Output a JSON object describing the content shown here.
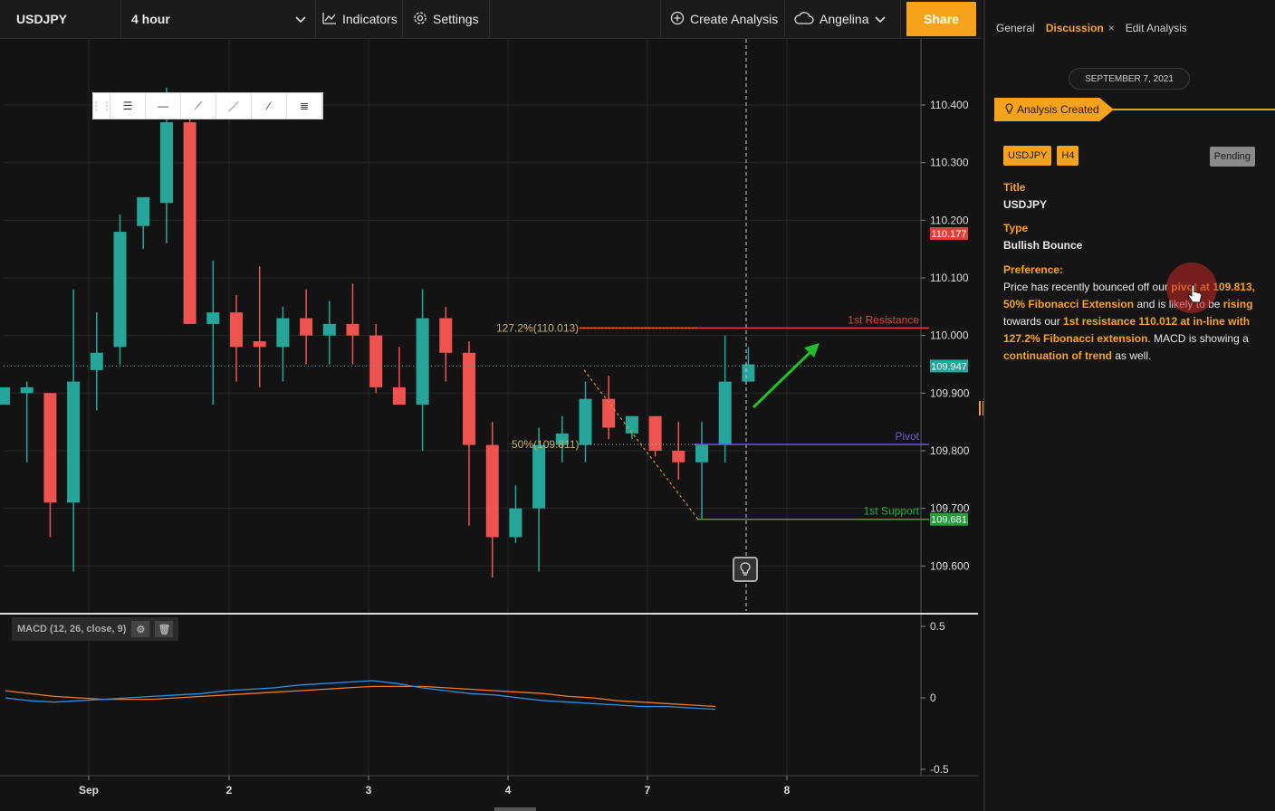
{
  "toolbar": {
    "symbol": "USDJPY",
    "interval": "4 hour",
    "indicators_label": "Indicators",
    "settings_label": "Settings",
    "create_analysis_label": "Create Analysis",
    "user_name": "Angelina",
    "share_label": "Share"
  },
  "panel": {
    "tabs": [
      {
        "label": "General"
      },
      {
        "label": "Discussion",
        "closable": true
      },
      {
        "label": "Edit Analysis"
      }
    ],
    "close_glyph": "×",
    "date": "SEPTEMBER 7, 2021",
    "event_label": "Analysis Created",
    "badges": [
      "USDJPY",
      "H4"
    ],
    "status": "Pending",
    "title_label": "Title",
    "title_value": "USDJPY",
    "type_label": "Type",
    "type_value": "Bullish Bounce",
    "preference_label": "Preference:",
    "preference_parts": [
      {
        "text": "Price has recently bounced off our ",
        "hl": false
      },
      {
        "text": "pivot at 109.813, 50% Fibonacci Extension",
        "hl": true
      },
      {
        "text": " and is likely to be ",
        "hl": false
      },
      {
        "text": "rising",
        "hl": true
      },
      {
        "text": " towards our ",
        "hl": false
      },
      {
        "text": "1st resistance 110.012 at in-line with 127.2% Fibonacci extension",
        "hl": true
      },
      {
        "text": ". MACD is showing a ",
        "hl": false
      },
      {
        "text": "continuation of trend",
        "hl": true
      },
      {
        "text": " as well.",
        "hl": false
      }
    ]
  },
  "chart": {
    "price_ticks": [
      "110.400",
      "110.300",
      "110.200",
      "110.100",
      "110.000",
      "109.900",
      "109.800",
      "109.700",
      "109.600"
    ],
    "x_ticks": [
      "Sep",
      "2",
      "3",
      "4",
      "7",
      "8"
    ],
    "macd_label": "MACD (12, 26, close, 9)",
    "macd_ticks": [
      "0.5",
      "0",
      "-0.5"
    ],
    "price_tags": [
      {
        "text": "110.177",
        "price": 110.177,
        "color": "#e0403a"
      },
      {
        "text": "109.947",
        "price": 109.947,
        "color": "#26a69a"
      },
      {
        "text": "109.681",
        "price": 109.681,
        "color": "#22a03a"
      }
    ],
    "levels": [
      {
        "label": "1st Resistance",
        "price": 110.013,
        "color": "#e0403a"
      },
      {
        "label": "Pivot",
        "price": 109.811,
        "color": "#6a5acd"
      },
      {
        "label": "1st Support",
        "price": 109.681,
        "color": "#22b03a"
      }
    ],
    "fib_labels": [
      "127.2%(110.013)",
      "50%(109.811)"
    ],
    "colors": {
      "up": "#26a69a",
      "down": "#ef5350",
      "accent": "#f7a21b"
    }
  },
  "chart_data": {
    "type": "candlestick",
    "candles": [
      {
        "o": 109.88,
        "h": 109.91,
        "l": 109.88,
        "c": 109.91
      },
      {
        "o": 109.9,
        "h": 109.92,
        "l": 109.78,
        "c": 109.91
      },
      {
        "o": 109.9,
        "h": 109.9,
        "l": 109.65,
        "c": 109.71
      },
      {
        "o": 109.71,
        "h": 110.08,
        "l": 109.59,
        "c": 109.92
      },
      {
        "o": 109.94,
        "h": 110.04,
        "l": 109.87,
        "c": 109.97
      },
      {
        "o": 109.98,
        "h": 110.21,
        "l": 109.95,
        "c": 110.18
      },
      {
        "o": 110.19,
        "h": 110.24,
        "l": 110.15,
        "c": 110.24
      },
      {
        "o": 110.23,
        "h": 110.43,
        "l": 110.16,
        "c": 110.37
      },
      {
        "o": 110.37,
        "h": 110.41,
        "l": 110.02,
        "c": 110.02
      },
      {
        "o": 110.02,
        "h": 110.13,
        "l": 109.88,
        "c": 110.04
      },
      {
        "o": 110.04,
        "h": 110.07,
        "l": 109.92,
        "c": 109.98
      },
      {
        "o": 109.99,
        "h": 110.12,
        "l": 109.91,
        "c": 109.98
      },
      {
        "o": 109.98,
        "h": 110.05,
        "l": 109.92,
        "c": 110.03
      },
      {
        "o": 110.03,
        "h": 110.08,
        "l": 109.95,
        "c": 110.0
      },
      {
        "o": 110.0,
        "h": 110.06,
        "l": 109.95,
        "c": 110.02
      },
      {
        "o": 110.02,
        "h": 110.09,
        "l": 109.95,
        "c": 110.0
      },
      {
        "o": 110.0,
        "h": 110.02,
        "l": 109.9,
        "c": 109.91
      },
      {
        "o": 109.91,
        "h": 109.98,
        "l": 109.88,
        "c": 109.88
      },
      {
        "o": 109.88,
        "h": 110.08,
        "l": 109.8,
        "c": 110.03
      },
      {
        "o": 110.03,
        "h": 110.05,
        "l": 109.92,
        "c": 109.97
      },
      {
        "o": 109.97,
        "h": 109.99,
        "l": 109.67,
        "c": 109.81
      },
      {
        "o": 109.81,
        "h": 109.85,
        "l": 109.58,
        "c": 109.65
      },
      {
        "o": 109.65,
        "h": 109.74,
        "l": 109.64,
        "c": 109.7
      },
      {
        "o": 109.7,
        "h": 109.84,
        "l": 109.59,
        "c": 109.81
      },
      {
        "o": 109.81,
        "h": 109.86,
        "l": 109.78,
        "c": 109.83
      },
      {
        "o": 109.81,
        "h": 109.92,
        "l": 109.78,
        "c": 109.89
      },
      {
        "o": 109.89,
        "h": 109.93,
        "l": 109.82,
        "c": 109.84
      },
      {
        "o": 109.83,
        "h": 109.86,
        "l": 109.82,
        "c": 109.86
      },
      {
        "o": 109.86,
        "h": 109.86,
        "l": 109.79,
        "c": 109.8
      },
      {
        "o": 109.8,
        "h": 109.85,
        "l": 109.75,
        "c": 109.78
      },
      {
        "o": 109.78,
        "h": 109.85,
        "l": 109.68,
        "c": 109.81
      },
      {
        "o": 109.81,
        "h": 110.0,
        "l": 109.78,
        "c": 109.92
      },
      {
        "o": 109.92,
        "h": 109.98,
        "l": 109.92,
        "c": 109.95
      }
    ],
    "macd": [
      0.0,
      -0.02,
      -0.03,
      -0.02,
      -0.01,
      0.0,
      0.01,
      0.02,
      0.03,
      0.05,
      0.06,
      0.07,
      0.09,
      0.1,
      0.11,
      0.12,
      0.1,
      0.07,
      0.05,
      0.03,
      0.02,
      0.0,
      -0.02,
      -0.03,
      -0.04,
      -0.05,
      -0.06,
      -0.06,
      -0.07,
      -0.08
    ],
    "signal": [
      0.05,
      0.03,
      0.01,
      0.0,
      -0.01,
      -0.01,
      -0.01,
      0.0,
      0.01,
      0.02,
      0.03,
      0.04,
      0.05,
      0.06,
      0.07,
      0.08,
      0.08,
      0.08,
      0.07,
      0.06,
      0.05,
      0.04,
      0.03,
      0.01,
      0.0,
      -0.02,
      -0.03,
      -0.04,
      -0.05,
      -0.06
    ],
    "ylim": [
      109.55,
      110.47
    ],
    "macd_ylim": [
      -0.5,
      0.5
    ]
  }
}
